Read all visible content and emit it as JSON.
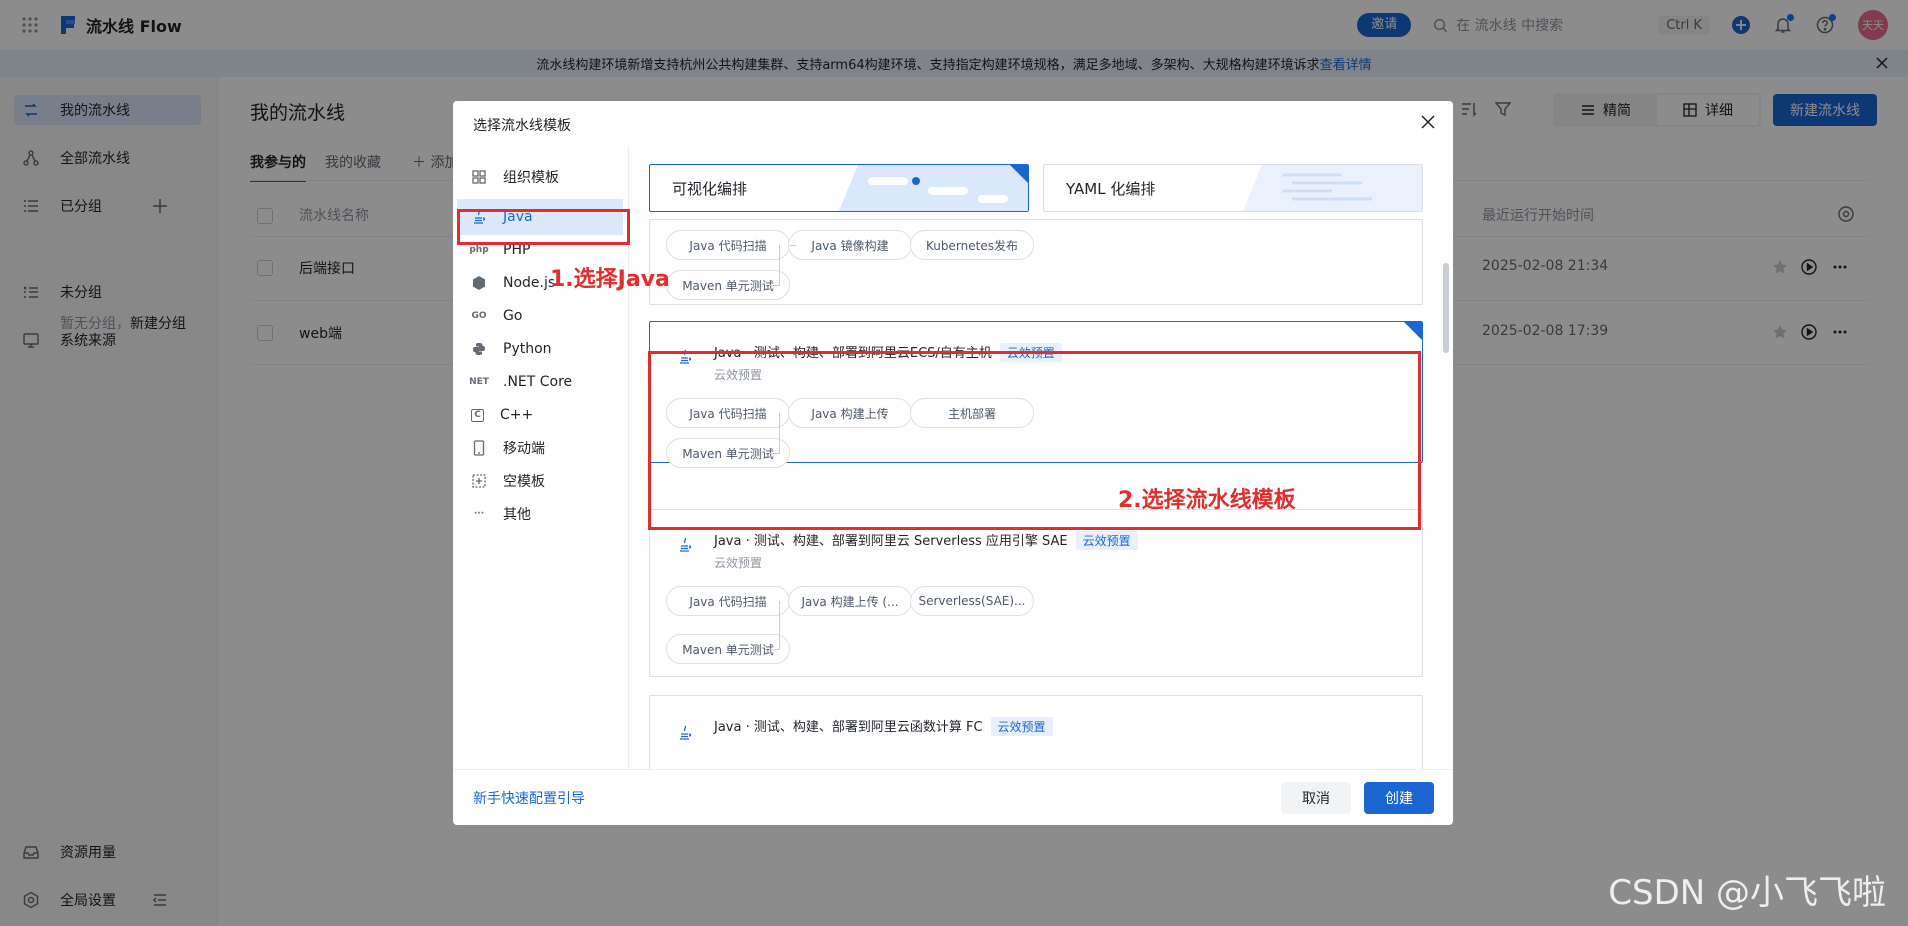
{
  "app": {
    "title": "流水线 Flow",
    "invite": "邀请",
    "search_placeholder": "在 流水线 中搜索",
    "shortcut": "Ctrl K",
    "avatar": "天天"
  },
  "banner": {
    "text": "流水线构建环境新增支持杭州公共构建集群、支持arm64构建环境、支持指定构建环境规格，满足多地域、多架构、大规格构建环境诉求",
    "link": "查看详情"
  },
  "sidebar": {
    "items": [
      {
        "label": "我的流水线",
        "icon": "pipeline-icon"
      },
      {
        "label": "全部流水线",
        "icon": "all-pipelines-icon"
      },
      {
        "label": "已分组",
        "icon": "group-icon"
      },
      {
        "label": "未分组",
        "icon": "ungrouped-icon"
      },
      {
        "label": "系统来源",
        "icon": "system-source-icon"
      }
    ],
    "group_hint": "暂无分组，",
    "group_create": "新建分组",
    "bottom": [
      {
        "label": "资源用量",
        "icon": "inbox-icon"
      },
      {
        "label": "全局设置",
        "icon": "settings-icon"
      }
    ]
  },
  "main": {
    "title": "我的流水线",
    "tabs": [
      "我参与的",
      "我的收藏",
      "添加"
    ],
    "view_modes": [
      "精简",
      "详细"
    ],
    "new_button": "新建流水线",
    "columns": [
      "流水线名称",
      "最近运行开始时间"
    ],
    "rows": [
      {
        "name": "后端接口",
        "time": "2025-02-08 21:34"
      },
      {
        "name": "web端",
        "time": "2025-02-08 17:39"
      }
    ]
  },
  "modal": {
    "title": "选择流水线模板",
    "nav": [
      {
        "label": "组织模板",
        "icon": "grid-icon",
        "glyph": ""
      },
      {
        "label": "Java",
        "icon": "java-icon",
        "glyph": ""
      },
      {
        "label": "PHP",
        "icon": "php-icon",
        "glyph": "php"
      },
      {
        "label": "Node.js",
        "icon": "nodejs-icon",
        "glyph": ""
      },
      {
        "label": "Go",
        "icon": "go-icon",
        "glyph": "GO"
      },
      {
        "label": "Python",
        "icon": "python-icon",
        "glyph": ""
      },
      {
        "label": ".NET Core",
        "icon": "dotnet-icon",
        "glyph": "NET"
      },
      {
        "label": "C++",
        "icon": "cpp-icon",
        "glyph": "C"
      },
      {
        "label": "移动端",
        "icon": "mobile-icon",
        "glyph": ""
      },
      {
        "label": "空模板",
        "icon": "empty-template-icon",
        "glyph": ""
      },
      {
        "label": "其他",
        "icon": "more-icon",
        "glyph": "···"
      }
    ],
    "modes": [
      "可视化编排",
      "YAML 化编排"
    ],
    "cards": [
      {
        "title": "",
        "badge": "",
        "sub": "",
        "stages": [
          "Java 代码扫描",
          "Maven 单元测试",
          "Java 镜像构建",
          "Kubernetes发布"
        ]
      },
      {
        "title": "Java · 测试、构建、部署到阿里云ECS/自有主机",
        "badge": "云效预置",
        "sub": "云效预置",
        "stages": [
          "Java 代码扫描",
          "Maven 单元测试",
          "Java 构建上传",
          "主机部署"
        ]
      },
      {
        "title": "Java · 测试、构建、部署到阿里云 Serverless 应用引擎 SAE",
        "badge": "云效预置",
        "sub": "云效预置",
        "stages": [
          "Java 代码扫描",
          "Maven 单元测试",
          "Java 构建上传 (...",
          "Serverless(SAE)..."
        ]
      },
      {
        "title": "Java · 测试、构建、部署到阿里云函数计算 FC",
        "badge": "云效预置",
        "sub": "",
        "stages": []
      }
    ],
    "annotations": [
      "1.选择Java",
      "2.选择流水线模板"
    ],
    "footer": {
      "guide": "新手快速配置引导",
      "cancel": "取消",
      "create": "创建"
    }
  },
  "watermark": "CSDN @小飞飞啦",
  "colors": {
    "primary": "#1b66d1",
    "annotation_red": "#e02d2d",
    "banner_bg": "#e8f0fd"
  }
}
